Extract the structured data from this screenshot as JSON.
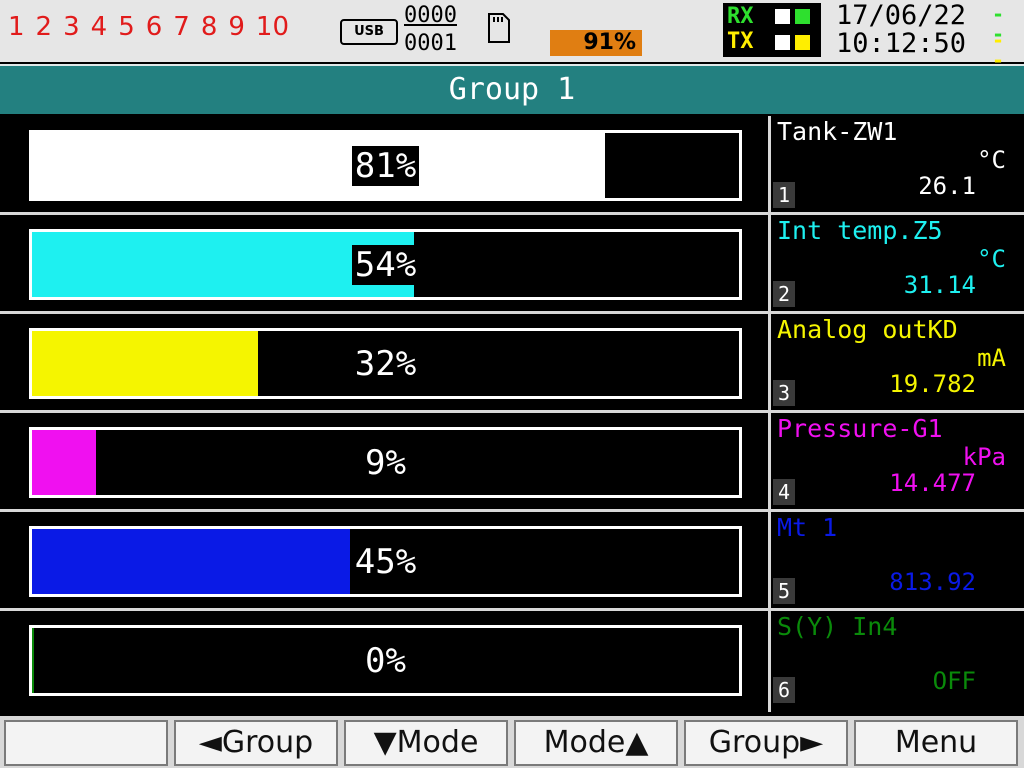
{
  "status": {
    "channels": [
      "1",
      "2",
      "3",
      "4",
      "5",
      "6",
      "7",
      "8",
      "9",
      "10"
    ],
    "usb_label": "USB",
    "counter_top": "0000",
    "counter_bottom": "0001",
    "sd_icon": "sd-card-icon",
    "memory_usage": "91%",
    "rx_label": "RX",
    "tx_label": "TX",
    "date": "17/06/22",
    "time": "10:12:50",
    "colors": {
      "channels": "#e11b1b",
      "memory": "#e07e12",
      "rx": "#2ee02e",
      "tx": "#ffee00"
    }
  },
  "group": {
    "title": "Group 1",
    "color": "#238080"
  },
  "bars": [
    {
      "percent_label": "81%",
      "fill": 0.81,
      "color": "#ffffff",
      "name": "Tank-ZW1",
      "unit": "°C",
      "value": "26.1",
      "number": "1"
    },
    {
      "percent_label": "54%",
      "fill": 0.54,
      "color": "#1ef0f0",
      "name": "Int temp.Z5",
      "unit": "°C",
      "value": "31.14",
      "number": "2"
    },
    {
      "percent_label": "32%",
      "fill": 0.32,
      "color": "#f5f500",
      "name": "Analog outKD",
      "unit": "mA",
      "value": "19.782",
      "number": "3"
    },
    {
      "percent_label": "9%",
      "fill": 0.09,
      "color": "#f010f0",
      "name": "Pressure-G1",
      "unit": "kPa",
      "value": "14.477",
      "number": "4"
    },
    {
      "percent_label": "45%",
      "fill": 0.45,
      "color": "#0a1ae6",
      "name": "Mt 1",
      "unit": "",
      "value": "813.92",
      "number": "5"
    },
    {
      "percent_label": "0%",
      "fill": 0.0,
      "color": "#0a8a0a",
      "name": "S(Y) In4",
      "unit": "",
      "value": "OFF",
      "number": "6"
    }
  ],
  "softkeys": [
    "",
    "◄Group",
    "▼Mode",
    "Mode▲",
    "Group►",
    "Menu"
  ]
}
